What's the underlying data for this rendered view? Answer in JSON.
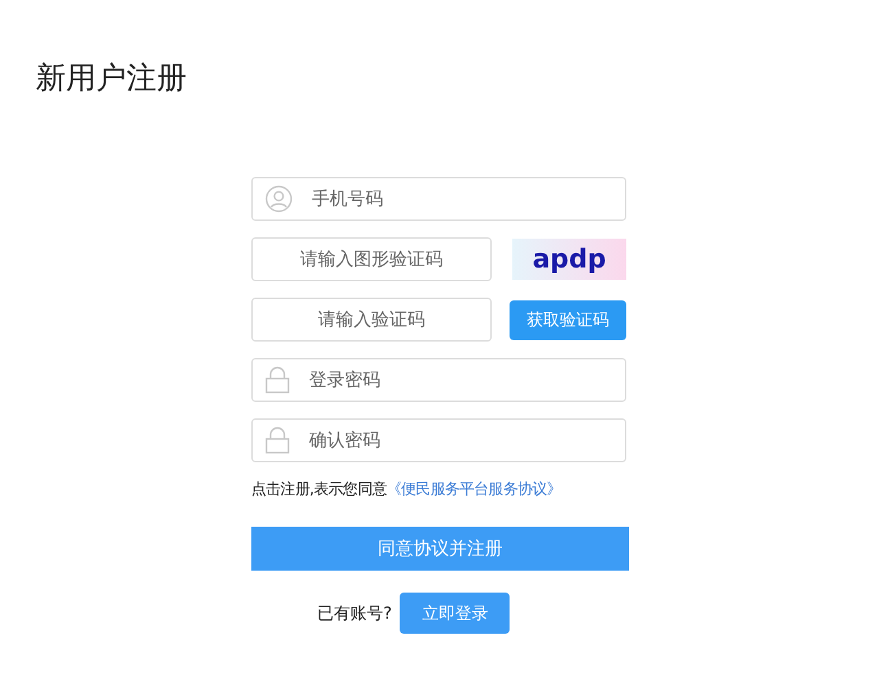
{
  "page_title": "新用户注册",
  "fields": [
    {
      "kind": "phone",
      "placeholder": "手机号码"
    },
    {
      "kind": "captcha",
      "placeholder": "请输入图形验证码",
      "captcha_text": "apdp"
    },
    {
      "kind": "sms",
      "placeholder": "请输入验证码",
      "button": "获取验证码"
    },
    {
      "kind": "password",
      "placeholder": "登录密码"
    },
    {
      "kind": "password",
      "placeholder": "确认密码"
    }
  ],
  "agreement": {
    "text": "点击注册,表示您同意",
    "link": "《便民服务平台服务协议》"
  },
  "submit_button": "同意协议并注册",
  "login": {
    "text": "已有账号?",
    "button": "立即登录"
  }
}
